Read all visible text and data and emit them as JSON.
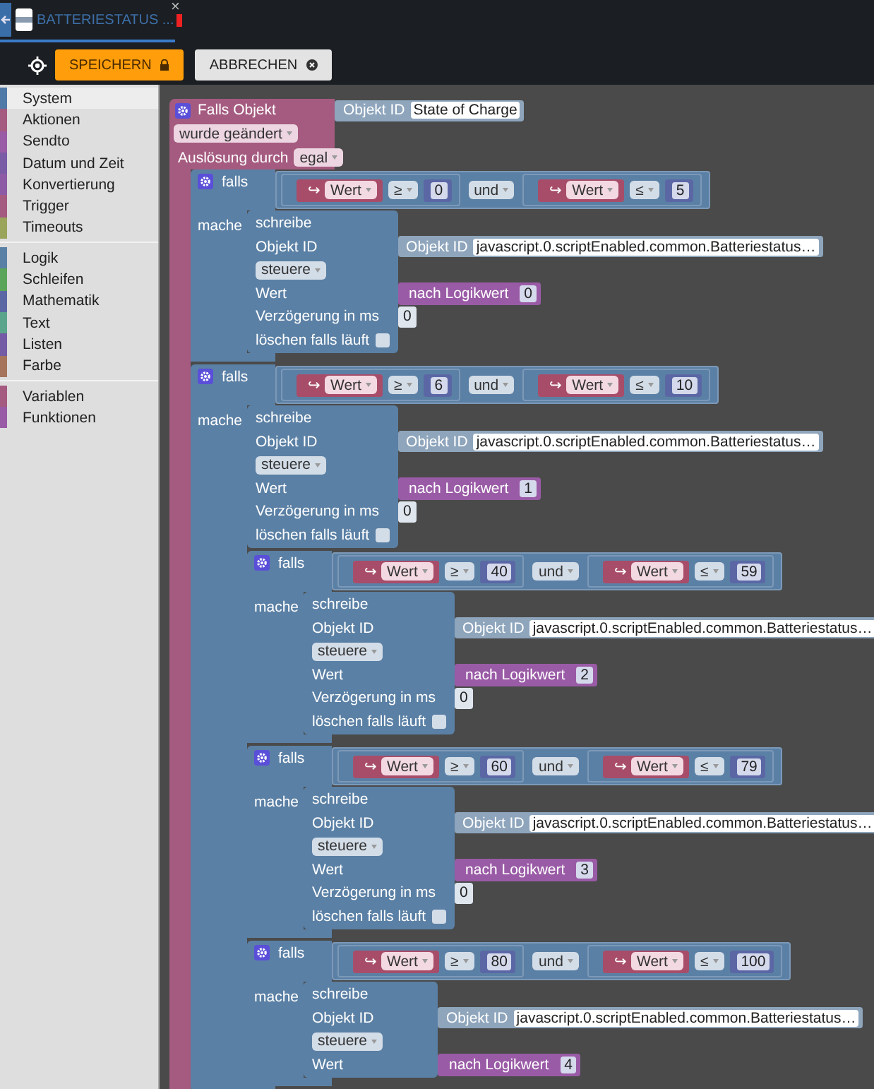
{
  "tab": {
    "title": "BATTERIESTATUS ...",
    "close": "×"
  },
  "toolbar": {
    "buttons": [
      {
        "kind": "save",
        "label": "SPEICHERN"
      },
      {
        "kind": "cancel",
        "label": "ABBRECHEN"
      }
    ]
  },
  "sidebar": {
    "groups": [
      [
        {
          "label": "System",
          "color": "#4f79a6",
          "selected": true
        },
        {
          "label": "Aktionen",
          "color": "#a55b80",
          "selected": false
        },
        {
          "label": "Sendto",
          "color": "#9a5ba6",
          "selected": false
        },
        {
          "label": "Datum und Zeit",
          "color": "#7a5ba6",
          "selected": false
        },
        {
          "label": "Konvertierung",
          "color": "#8d5ba6",
          "selected": false
        },
        {
          "label": "Trigger",
          "color": "#a55b80",
          "selected": false
        },
        {
          "label": "Timeouts",
          "color": "#9aa55b",
          "selected": false
        }
      ],
      [
        {
          "label": "Logik",
          "color": "#5b80a5",
          "selected": false
        },
        {
          "label": "Schleifen",
          "color": "#5ba55b",
          "selected": false
        },
        {
          "label": "Mathematik",
          "color": "#5b67a5",
          "selected": false
        },
        {
          "label": "Text",
          "color": "#5ba58c",
          "selected": false
        },
        {
          "label": "Listen",
          "color": "#745ba5",
          "selected": false
        },
        {
          "label": "Farbe",
          "color": "#a5745b",
          "selected": false
        }
      ],
      [
        {
          "label": "Variablen",
          "color": "#a55b80",
          "selected": false
        },
        {
          "label": "Funktionen",
          "color": "#995ba5",
          "selected": false
        }
      ]
    ]
  },
  "workspace": {
    "event": {
      "title": "Falls Objekt",
      "object_label": "Objekt ID",
      "object_value": "State of Charge",
      "trigger": "wurde geändert",
      "by_label": "Auslösung durch",
      "by_value": "egal",
      "statements": [
        {
          "kind": "if",
          "label": "falls",
          "do_label": "mache",
          "condition": {
            "operator": "und",
            "left": {
              "arrow": "↪",
              "var": "Wert",
              "op": "≥",
              "value": "0"
            },
            "right": {
              "arrow": "↪",
              "var": "Wert",
              "op": "≤",
              "value": "5"
            }
          },
          "statements": [
            {
              "kind": "write",
              "label": "schreibe",
              "object_label": "Objekt ID",
              "object_block": "Objekt ID",
              "object_value": "javascript.0.scriptEnabled.common.Batteriestatus…",
              "mode": "steuere",
              "value_label": "Wert",
              "value_block": "nach Logikwert",
              "value": "0",
              "delay_label": "Verzögerung in ms",
              "delay": "0",
              "clear_label": "löschen falls läuft",
              "clear": false
            }
          ]
        },
        {
          "kind": "if",
          "label": "falls",
          "do_label": "mache",
          "condition": {
            "operator": "und",
            "left": {
              "arrow": "↪",
              "var": "Wert",
              "op": "≥",
              "value": "6"
            },
            "right": {
              "arrow": "↪",
              "var": "Wert",
              "op": "≤",
              "value": "10"
            }
          },
          "statements": [
            {
              "kind": "write",
              "label": "schreibe",
              "object_label": "Objekt ID",
              "object_block": "Objekt ID",
              "object_value": "javascript.0.scriptEnabled.common.Batteriestatus…",
              "mode": "steuere",
              "value_label": "Wert",
              "value_block": "nach Logikwert",
              "value": "1",
              "delay_label": "Verzögerung in ms",
              "delay": "0",
              "clear_label": "löschen falls läuft",
              "clear": false
            },
            {
              "kind": "if",
              "label": "falls",
              "do_label": "mache",
              "condition": {
                "operator": "und",
                "left": {
                  "arrow": "↪",
                  "var": "Wert",
                  "op": "≥",
                  "value": "40"
                },
                "right": {
                  "arrow": "↪",
                  "var": "Wert",
                  "op": "≤",
                  "value": "59"
                }
              },
              "statements": [
                {
                  "kind": "write",
                  "label": "schreibe",
                  "object_label": "Objekt ID",
                  "object_block": "Objekt ID",
                  "object_value": "javascript.0.scriptEnabled.common.Batteriestatus…",
                  "mode": "steuere",
                  "value_label": "Wert",
                  "value_block": "nach Logikwert",
                  "value": "2",
                  "delay_label": "Verzögerung in ms",
                  "delay": "0",
                  "clear_label": "löschen falls läuft",
                  "clear": false
                }
              ]
            },
            {
              "kind": "if",
              "label": "falls",
              "do_label": "mache",
              "condition": {
                "operator": "und",
                "left": {
                  "arrow": "↪",
                  "var": "Wert",
                  "op": "≥",
                  "value": "60"
                },
                "right": {
                  "arrow": "↪",
                  "var": "Wert",
                  "op": "≤",
                  "value": "79"
                }
              },
              "statements": [
                {
                  "kind": "write",
                  "label": "schreibe",
                  "object_label": "Objekt ID",
                  "object_block": "Objekt ID",
                  "object_value": "javascript.0.scriptEnabled.common.Batteriestatus…",
                  "mode": "steuere",
                  "value_label": "Wert",
                  "value_block": "nach Logikwert",
                  "value": "3",
                  "delay_label": "Verzögerung in ms",
                  "delay": "0",
                  "clear_label": "löschen falls läuft",
                  "clear": false
                }
              ]
            },
            {
              "kind": "if",
              "label": "falls",
              "do_label": "mache",
              "condition": {
                "operator": "und",
                "left": {
                  "arrow": "↪",
                  "var": "Wert",
                  "op": "≥",
                  "value": "80"
                },
                "right": {
                  "arrow": "↪",
                  "var": "Wert",
                  "op": "≤",
                  "value": "100"
                }
              },
              "statements": [
                {
                  "kind": "write",
                  "label": "schreibe",
                  "object_label": "Objekt ID",
                  "object_block": "Objekt ID",
                  "object_value": "javascript.0.scriptEnabled.common.Batteriestatus…",
                  "mode": "steuere",
                  "value_label": "Wert",
                  "value_block": "nach Logikwert",
                  "value": "4"
                }
              ]
            }
          ]
        }
      ]
    }
  }
}
